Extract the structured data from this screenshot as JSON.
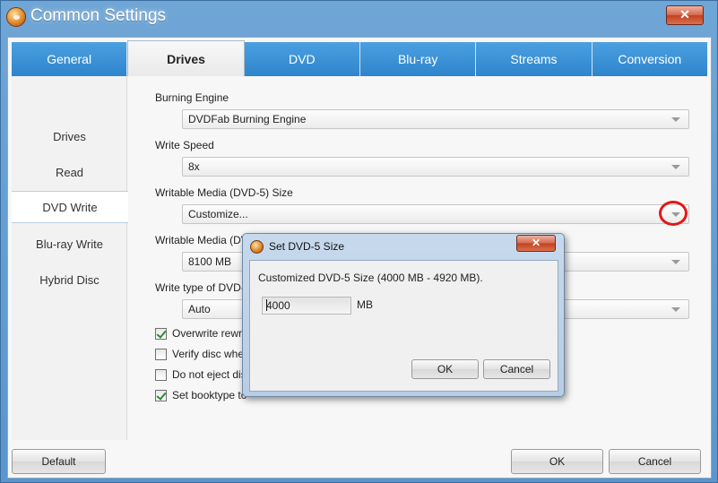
{
  "window": {
    "title": "Common Settings",
    "close_glyph": "✕",
    "app_icon": "dvdfab-logo-icon"
  },
  "tabs": [
    {
      "label": "General",
      "active": false
    },
    {
      "label": "Drives",
      "active": true
    },
    {
      "label": "DVD",
      "active": false
    },
    {
      "label": "Blu-ray",
      "active": false
    },
    {
      "label": "Streams",
      "active": false
    },
    {
      "label": "Conversion",
      "active": false
    }
  ],
  "sidebar": {
    "items": [
      {
        "label": "Drives",
        "active": false
      },
      {
        "label": "Read",
        "active": false
      },
      {
        "label": "DVD Write",
        "active": true
      },
      {
        "label": "Blu-ray Write",
        "active": false
      },
      {
        "label": "Hybrid Disc",
        "active": false
      }
    ]
  },
  "settings": {
    "burning_engine": {
      "label": "Burning Engine",
      "value": "DVDFab Burning Engine"
    },
    "write_speed": {
      "label": "Write Speed",
      "value": "8x"
    },
    "media_size": {
      "label": "Writable Media (DVD-5) Size",
      "value": "Customize..."
    },
    "media_size_dl": {
      "label": "Writable Media (DVD",
      "value": "8100 MB"
    },
    "write_type": {
      "label": "Write type of DVD-R",
      "value": "Auto"
    },
    "checkboxes": [
      {
        "label": "Overwrite rewrita",
        "checked": true
      },
      {
        "label": "Verify disc when",
        "checked": false
      },
      {
        "label": "Do not eject disc",
        "checked": false
      },
      {
        "label": "Set booktype to",
        "checked": true
      }
    ]
  },
  "footer": {
    "default_label": "Default",
    "ok_label": "OK",
    "cancel_label": "Cancel"
  },
  "dialog": {
    "title": "Set DVD-5 Size",
    "close_glyph": "✕",
    "message": "Customized DVD-5 Size (4000 MB - 4920 MB).",
    "input_value": "4000",
    "unit": "MB",
    "ok_label": "OK",
    "cancel_label": "Cancel"
  },
  "colors": {
    "tab_blue": "#2f85cc",
    "title_bar": "#5b95cb",
    "highlight_circle": "#e01818",
    "close_red": "#c3421f"
  }
}
